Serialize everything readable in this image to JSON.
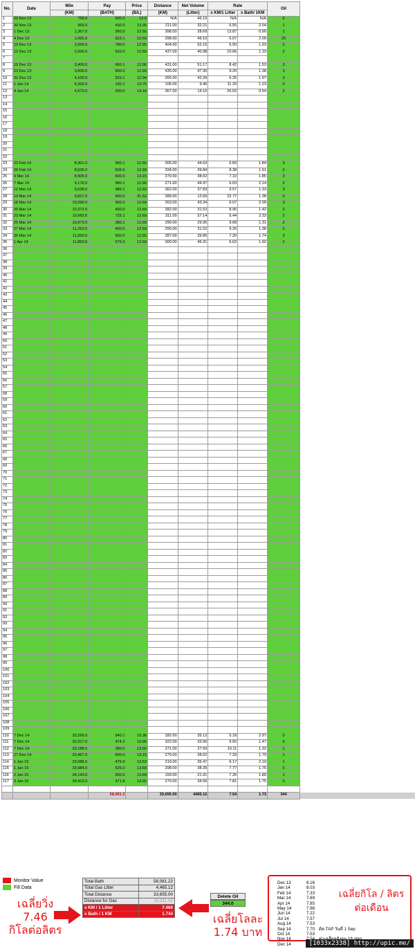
{
  "columns": {
    "no": "No.",
    "date": "Date",
    "mile": "Mile",
    "mile_unit": "(KM)",
    "pay": "Pay",
    "pay_unit": "(BATH)",
    "price": "Price",
    "price_unit": "(B/L)",
    "distance": "Distance",
    "distance_unit": "(KM)",
    "volume": "Net Volume",
    "volume_unit": "(Litter)",
    "rate": "Rate",
    "rate_km": "x KM/1 Litter",
    "rate_bath": "x Bath/ 1KM",
    "oil": "Oil"
  },
  "rows": [
    [
      "1",
      "29 Nov 13",
      "758.0",
      "600.0",
      "13.0",
      "N/A",
      "46.19",
      "N/A",
      "N/A",
      "0",
      ""
    ],
    [
      "2",
      "30 Nov 13",
      "969.0",
      "430.0",
      "13.35",
      "211.00",
      "32.21",
      "6.55",
      "2.04",
      "1",
      ""
    ],
    [
      "3",
      "1 Dec 13",
      "1,367.0",
      "360.0",
      "12.55",
      "398.00",
      "28.69",
      "13.87",
      "0.90",
      "1",
      ""
    ],
    [
      "4",
      "4 Dec 13",
      "1,665.0",
      "623.1",
      "12.69",
      "298.00",
      "49.10",
      "6.07",
      "2.09",
      "25",
      ""
    ],
    [
      "5",
      "10 Dec 13",
      "2,069.0",
      "780.0",
      "12.55",
      "404.00",
      "62.15",
      "6.50",
      "1.93",
      "2",
      ""
    ],
    [
      "6",
      "12 Dec 13",
      "2,506.0",
      "520.0",
      "12.69",
      "437.00",
      "40.98",
      "10.66",
      "1.19",
      "2",
      ""
    ],
    [
      "7",
      "",
      "",
      "",
      "",
      "",
      "",
      "",
      "",
      "",
      ""
    ],
    [
      "8",
      "19 Dec 13",
      "3,400.0",
      "660.1",
      "12.90",
      "431.00",
      "51.17",
      "8.42",
      "1.53",
      "3",
      ""
    ],
    [
      "9",
      "23 Dec 13",
      "3,835.0",
      "600.0",
      "12.69",
      "435.00",
      "47.30",
      "9.20",
      "1.38",
      "3",
      ""
    ],
    [
      "10",
      "31 Dec 13",
      "4,100.0",
      "523.1",
      "12.34",
      "265.00",
      "42.39",
      "6.25",
      "1.97",
      "3",
      ""
    ],
    [
      "11",
      "1 Jan 14",
      "4,206.0",
      "130.1",
      "13.75",
      "106.00",
      "9.46",
      "11.20",
      "1.23",
      "0",
      ""
    ],
    [
      "12",
      "4 Jan 14",
      "4,573.0",
      "200.0",
      "14.18",
      "367.00",
      "14.10",
      "26.02",
      "0.54",
      "2",
      ""
    ],
    [
      "13",
      "",
      "",
      "",
      "",
      "",
      "",
      "",
      "",
      "",
      ""
    ],
    [
      "14",
      "",
      "",
      "",
      "",
      "",
      "",
      "",
      "",
      "",
      ""
    ],
    [
      "15",
      "",
      "",
      "",
      "",
      "",
      "",
      "",
      "",
      "",
      ""
    ],
    [
      "16",
      "",
      "",
      "",
      "",
      "",
      "",
      "",
      "",
      "",
      ""
    ],
    [
      "17",
      "",
      "",
      "",
      "",
      "",
      "",
      "",
      "",
      "",
      ""
    ],
    [
      "18",
      "",
      "",
      "",
      "",
      "",
      "",
      "",
      "",
      "",
      ""
    ],
    [
      "19",
      "",
      "",
      "",
      "",
      "",
      "",
      "",
      "",
      "",
      ""
    ],
    [
      "20",
      "",
      "",
      "",
      "",
      "",
      "",
      "",
      "",
      "",
      ""
    ],
    [
      "21",
      "",
      "",
      "",
      "",
      "",
      "",
      "",
      "",
      "",
      ""
    ],
    [
      "22",
      "",
      "",
      "",
      "",
      "",
      "",
      "",
      "",
      "",
      ""
    ],
    [
      "23",
      "22 Feb 14",
      "8,301.0",
      "560.1",
      "12.55",
      "305.00",
      "44.63",
      "6.83",
      "1.84",
      "3",
      ""
    ],
    [
      "24",
      "26 Feb 14",
      "8,635.0",
      "505.6",
      "12.69",
      "334.00",
      "39.84",
      "8.38",
      "1.51",
      "2",
      ""
    ],
    [
      "25",
      "4 Mar 14",
      "8,905.0",
      "500.0",
      "13.15",
      "270.00",
      "38.02",
      "7.10",
      "1.85",
      "3",
      ""
    ],
    [
      "26",
      "7 Mar 14",
      "9,176.0",
      "580.1",
      "12.90",
      "271.00",
      "44.97",
      "6.03",
      "2.14",
      "2",
      ""
    ],
    [
      "27",
      "12 Mar 14",
      "9,538.0",
      "480.1",
      "12.69",
      "362.00",
      "37.83",
      "9.57",
      "1.33",
      "3",
      ""
    ],
    [
      "28",
      "14 Mar 14",
      "9,827.0",
      "400.0",
      "31.52",
      "289.00",
      "12.69",
      "22.77",
      "1.38",
      "0",
      ""
    ],
    [
      "29",
      "18 Mar 14",
      "10,090.0",
      "550.0",
      "12.69",
      "263.00",
      "43.34",
      "6.07",
      "2.09",
      "3",
      ""
    ],
    [
      "30",
      "20 Mar 14",
      "10,372.0",
      "400.0",
      "12.69",
      "282.00",
      "31.52",
      "8.95",
      "1.42",
      "2",
      ""
    ],
    [
      "31",
      "23 Mar 14",
      "10,683.0",
      "725.1",
      "12.69",
      "311.00",
      "57.14",
      "5.44",
      "2.33",
      "2",
      ""
    ],
    [
      "32",
      "25 Mar 14",
      "10,973.0",
      "380.1",
      "12.69",
      "290.00",
      "29.95",
      "9.68",
      "1.31",
      "2",
      ""
    ],
    [
      "33",
      "27 Mar 14",
      "11,263.0",
      "400.0",
      "12.69",
      "290.00",
      "31.52",
      "9.20",
      "1.38",
      "2",
      ""
    ],
    [
      "34",
      "30 Mar 14",
      "11,550.0",
      "500.0",
      "12.55",
      "287.00",
      "39.85",
      "7.20",
      "1.74",
      "3",
      ""
    ],
    [
      "35",
      "1 Apr 14",
      "11,850.0",
      "575.0",
      "12.69",
      "300.00",
      "45.31",
      "6.62",
      "1.92",
      "2",
      ""
    ],
    [
      "36",
      "",
      "",
      "",
      "",
      "",
      "",
      "",
      "",
      "",
      ""
    ],
    [
      "37",
      "",
      "",
      "",
      "",
      "",
      "",
      "",
      "",
      "",
      ""
    ],
    [
      "38",
      "",
      "",
      "",
      "",
      "",
      "",
      "",
      "",
      "",
      ""
    ],
    [
      "39",
      "",
      "",
      "",
      "",
      "",
      "",
      "",
      "",
      "",
      ""
    ],
    [
      "40",
      "",
      "",
      "",
      "",
      "",
      "",
      "",
      "",
      "",
      ""
    ],
    [
      "41",
      "",
      "",
      "",
      "",
      "",
      "",
      "",
      "",
      "",
      ""
    ],
    [
      "42",
      "",
      "",
      "",
      "",
      "",
      "",
      "",
      "",
      "",
      ""
    ],
    [
      "43",
      "",
      "",
      "",
      "",
      "",
      "",
      "",
      "",
      "",
      ""
    ],
    [
      "44",
      "",
      "",
      "",
      "",
      "",
      "",
      "",
      "",
      "",
      ""
    ],
    [
      "45",
      "",
      "",
      "",
      "",
      "",
      "",
      "",
      "",
      "",
      ""
    ],
    [
      "46",
      "",
      "",
      "",
      "",
      "",
      "",
      "",
      "",
      "",
      ""
    ],
    [
      "47",
      "",
      "",
      "",
      "",
      "",
      "",
      "",
      "",
      "",
      ""
    ],
    [
      "48",
      "",
      "",
      "",
      "",
      "",
      "",
      "",
      "",
      "",
      ""
    ],
    [
      "49",
      "",
      "",
      "",
      "",
      "",
      "",
      "",
      "",
      "",
      ""
    ],
    [
      "50",
      "",
      "",
      "",
      "",
      "",
      "",
      "",
      "",
      "",
      ""
    ],
    [
      "51",
      "",
      "",
      "",
      "",
      "",
      "",
      "",
      "",
      "",
      ""
    ],
    [
      "52",
      "",
      "",
      "",
      "",
      "",
      "",
      "",
      "",
      "",
      ""
    ],
    [
      "53",
      "",
      "",
      "",
      "",
      "",
      "",
      "",
      "",
      "",
      ""
    ],
    [
      "54",
      "",
      "",
      "",
      "",
      "",
      "",
      "",
      "",
      "",
      ""
    ],
    [
      "55",
      "",
      "",
      "",
      "",
      "",
      "",
      "",
      "",
      "",
      ""
    ],
    [
      "56",
      "",
      "",
      "",
      "",
      "",
      "",
      "",
      "",
      "",
      ""
    ],
    [
      "57",
      "",
      "",
      "",
      "",
      "",
      "",
      "",
      "",
      "",
      ""
    ],
    [
      "58",
      "",
      "",
      "",
      "",
      "",
      "",
      "",
      "",
      "",
      ""
    ],
    [
      "59",
      "",
      "",
      "",
      "",
      "",
      "",
      "",
      "",
      "",
      ""
    ],
    [
      "60",
      "",
      "",
      "",
      "",
      "",
      "",
      "",
      "",
      "",
      ""
    ],
    [
      "61",
      "",
      "",
      "",
      "",
      "",
      "",
      "",
      "",
      "",
      ""
    ],
    [
      "62",
      "",
      "",
      "",
      "",
      "",
      "",
      "",
      "",
      "",
      ""
    ],
    [
      "63",
      "",
      "",
      "",
      "",
      "",
      "",
      "",
      "",
      "",
      ""
    ],
    [
      "64",
      "",
      "",
      "",
      "",
      "",
      "",
      "",
      "",
      "",
      ""
    ],
    [
      "65",
      "",
      "",
      "",
      "",
      "",
      "",
      "",
      "",
      "",
      ""
    ],
    [
      "66",
      "",
      "",
      "",
      "",
      "",
      "",
      "",
      "",
      "",
      ""
    ],
    [
      "67",
      "",
      "",
      "",
      "",
      "",
      "",
      "",
      "",
      "",
      ""
    ],
    [
      "68",
      "",
      "",
      "",
      "",
      "",
      "",
      "",
      "",
      "",
      ""
    ],
    [
      "69",
      "",
      "",
      "",
      "",
      "",
      "",
      "",
      "",
      "",
      ""
    ],
    [
      "70",
      "",
      "",
      "",
      "",
      "",
      "",
      "",
      "",
      "",
      ""
    ],
    [
      "71",
      "",
      "",
      "",
      "",
      "",
      "",
      "",
      "",
      "",
      ""
    ],
    [
      "72",
      "",
      "",
      "",
      "",
      "",
      "",
      "",
      "",
      "",
      ""
    ],
    [
      "73",
      "",
      "",
      "",
      "",
      "",
      "",
      "",
      "",
      "",
      ""
    ],
    [
      "74",
      "",
      "",
      "",
      "",
      "",
      "",
      "",
      "",
      "",
      ""
    ],
    [
      "75",
      "",
      "",
      "",
      "",
      "",
      "",
      "",
      "",
      "",
      ""
    ],
    [
      "76",
      "",
      "",
      "",
      "",
      "",
      "",
      "",
      "",
      "",
      ""
    ],
    [
      "77",
      "",
      "",
      "",
      "",
      "",
      "",
      "",
      "",
      "",
      ""
    ],
    [
      "78",
      "",
      "",
      "",
      "",
      "",
      "",
      "",
      "",
      "",
      ""
    ],
    [
      "79",
      "",
      "",
      "",
      "",
      "",
      "",
      "",
      "",
      "",
      ""
    ],
    [
      "80",
      "",
      "",
      "",
      "",
      "",
      "",
      "",
      "",
      "",
      ""
    ],
    [
      "81",
      "",
      "",
      "",
      "",
      "",
      "",
      "",
      "",
      "",
      ""
    ],
    [
      "82",
      "",
      "",
      "",
      "",
      "",
      "",
      "",
      "",
      "",
      ""
    ],
    [
      "83",
      "",
      "",
      "",
      "",
      "",
      "",
      "",
      "",
      "",
      ""
    ],
    [
      "84",
      "",
      "",
      "",
      "",
      "",
      "",
      "",
      "",
      "",
      ""
    ],
    [
      "85",
      "",
      "",
      "",
      "",
      "",
      "",
      "",
      "",
      "",
      ""
    ],
    [
      "86",
      "",
      "",
      "",
      "",
      "",
      "",
      "",
      "",
      "",
      ""
    ],
    [
      "87",
      "",
      "",
      "",
      "",
      "",
      "",
      "",
      "",
      "",
      ""
    ],
    [
      "88",
      "",
      "",
      "",
      "",
      "",
      "",
      "",
      "",
      "",
      ""
    ],
    [
      "89",
      "",
      "",
      "",
      "",
      "",
      "",
      "",
      "",
      "",
      ""
    ],
    [
      "90",
      "",
      "",
      "",
      "",
      "",
      "",
      "",
      "",
      "",
      ""
    ],
    [
      "91",
      "",
      "",
      "",
      "",
      "",
      "",
      "",
      "",
      "",
      ""
    ],
    [
      "92",
      "",
      "",
      "",
      "",
      "",
      "",
      "",
      "",
      "",
      ""
    ],
    [
      "93",
      "",
      "",
      "",
      "",
      "",
      "",
      "",
      "",
      "",
      ""
    ],
    [
      "94",
      "",
      "",
      "",
      "",
      "",
      "",
      "",
      "",
      "",
      ""
    ],
    [
      "95",
      "",
      "",
      "",
      "",
      "",
      "",
      "",
      "",
      "",
      ""
    ],
    [
      "96",
      "",
      "",
      "",
      "",
      "",
      "",
      "",
      "",
      "",
      ""
    ],
    [
      "97",
      "",
      "",
      "",
      "",
      "",
      "",
      "",
      "",
      "",
      ""
    ],
    [
      "98",
      "",
      "",
      "",
      "",
      "",
      "",
      "",
      "",
      "",
      ""
    ],
    [
      "99",
      "",
      "",
      "",
      "",
      "",
      "",
      "",
      "",
      "",
      ""
    ],
    [
      "100",
      "",
      "",
      "",
      "",
      "",
      "",
      "",
      "",
      "",
      ""
    ],
    [
      "101",
      "",
      "",
      "",
      "",
      "",
      "",
      "",
      "",
      "",
      ""
    ],
    [
      "102",
      "",
      "",
      "",
      "",
      "",
      "",
      "",
      "",
      "",
      ""
    ],
    [
      "103",
      "",
      "",
      "",
      "",
      "",
      "",
      "",
      "",
      "",
      ""
    ],
    [
      "104",
      "",
      "",
      "",
      "",
      "",
      "",
      "",
      "",
      "",
      ""
    ],
    [
      "105",
      "",
      "",
      "",
      "",
      "",
      "",
      "",
      "",
      "",
      ""
    ],
    [
      "106",
      "",
      "",
      "",
      "",
      "",
      "",
      "",
      "",
      "",
      ""
    ],
    [
      "107",
      "",
      "",
      "",
      "",
      "",
      "",
      "",
      "",
      "",
      ""
    ],
    [
      "108",
      "",
      "",
      "",
      "",
      "",
      "",
      "",
      "",
      "",
      ""
    ],
    [
      "109",
      "",
      "",
      "",
      "",
      "",
      "",
      "",
      "",
      "",
      ""
    ],
    [
      "110",
      "7 Dec 14",
      "32,595.0",
      "540.1",
      "15.38",
      "182.00",
      "35.12",
      "5.18",
      "2.97",
      "0",
      ""
    ],
    [
      "111",
      "7 Dec 14",
      "32,917.0",
      "474.2",
      "13.99",
      "322.00",
      "33.90",
      "9.50",
      "1.47",
      "0",
      ""
    ],
    [
      "112",
      "7 Dec 14",
      "33,188.0",
      "380.0",
      "13.60",
      "271.00",
      "27.69",
      "10.11",
      "1.32",
      "1",
      ""
    ],
    [
      "113",
      "27 Dec 14",
      "33,467.0",
      "500.0",
      "13.15",
      "279.00",
      "38.02",
      "7.33",
      "1.79",
      "1",
      ""
    ],
    [
      "114",
      "1 Jan 15",
      "33,686.0",
      "479.9",
      "13.53",
      "219.00",
      "35.47",
      "6.17",
      "2.19",
      "1",
      ""
    ],
    [
      "115",
      "1 Jan 15",
      "33,984.0",
      "525.0",
      "13.69",
      "298.00",
      "38.35",
      "7.77",
      "1.76",
      "0",
      ""
    ],
    [
      "116",
      "2 Jan 15",
      "34,143.0",
      "300.0",
      "13.69",
      "159.00",
      "21.91",
      "7.26",
      "1.89",
      "1",
      ""
    ],
    [
      "117",
      "3 Jan 15",
      "34,413.0",
      "471.8",
      "13.65",
      "270.00",
      "34.56",
      "7.81",
      "1.75",
      "0",
      ""
    ]
  ],
  "totals": {
    "pay": "58,081.2",
    "distance": "33,655.00",
    "volume": "4465.12",
    "rate_km": "7.54",
    "rate_bath": "1.73",
    "oil": "344"
  },
  "legend": {
    "monitor": "Monitor Value",
    "monitor_color": "#e3141b",
    "fill": "Fill Data",
    "fill_color": "#5fcf3c"
  },
  "summary": [
    {
      "label": "Total Bath",
      "value": "58,081.22"
    },
    {
      "label": "Total Gas Litter",
      "value": "4,465.12"
    },
    {
      "label": "Total Distance",
      "value": "33,655.00"
    },
    {
      "label": "Distance for Gas",
      "value": "33,311.00"
    },
    {
      "label": "x KM / 1 Litter",
      "value": "7.460"
    },
    {
      "label": "x Bath /  1 KM",
      "value": "1.744"
    }
  ],
  "delete_oil": {
    "label": "Delete Oil",
    "value": "344.0"
  },
  "annotations": {
    "km_per_liter": [
      "เฉลี่ยวิ่ง",
      "7.46",
      "กิโลต่อลิตร"
    ],
    "bath_per_km": [
      "เฉลี่ยโลละ",
      "1.74 บาท"
    ]
  },
  "monthly": {
    "title": [
      "เฉลี่ยกิโล / ลิตร",
      "ต่อเดือน"
    ],
    "items": [
      {
        "month": "Dec 13",
        "value": "8.16",
        "note": ""
      },
      {
        "month": "Jan 14",
        "value": "8.03",
        "note": ""
      },
      {
        "month": "Feb 14",
        "value": "7.33",
        "note": ""
      },
      {
        "month": "Mar 14",
        "value": "7.69",
        "note": ""
      },
      {
        "month": "Apr 14",
        "value": "7.85",
        "note": ""
      },
      {
        "month": "May 14",
        "value": "7.98",
        "note": ""
      },
      {
        "month": "Jun 14",
        "value": "7.22",
        "note": ""
      },
      {
        "month": "Jul 14",
        "value": "7.57",
        "note": ""
      },
      {
        "month": "Aug 14",
        "value": "7.53",
        "note": ""
      },
      {
        "month": "Sep 14",
        "value": "7.70",
        "note": "ติด TAP วันที่ 1 Sep"
      },
      {
        "month": "Oct 14",
        "value": "7.53",
        "note": ""
      },
      {
        "month": "Nov 14",
        "value": "7.54",
        "note": "ค่าเฉลี่ยหลังจูน 18 step"
      },
      {
        "month": "Dec 14",
        "value": "7.47",
        "note": "ค่าเฉลี่ยหลังขับไปเที่ยว"
      }
    ]
  },
  "watermark": "[1033x2338] http://upic.me/"
}
